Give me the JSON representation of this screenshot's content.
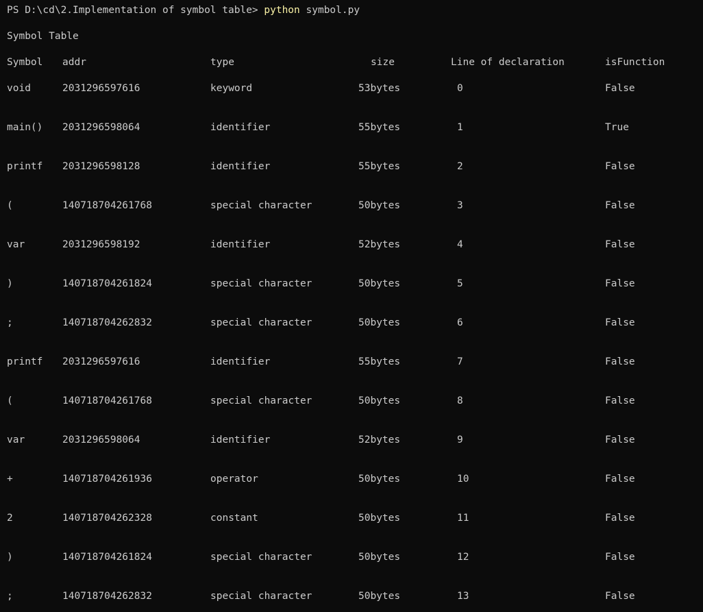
{
  "prompt": {
    "ps_prefix": "PS D:\\cd\\2.Implementation of symbol table> ",
    "command_exe": "python",
    "command_args": " symbol.py"
  },
  "heading": "Symbol Table",
  "table": {
    "headers": {
      "symbol": "Symbol",
      "addr": "addr",
      "type": "type",
      "size": "size",
      "line": "Line of declaration",
      "isfunction": "isFunction"
    },
    "rows": [
      {
        "symbol": "void",
        "addr": "2031296597616",
        "type": "keyword",
        "size": "53bytes",
        "line": "0",
        "isfunction": "False"
      },
      {
        "symbol": "main()",
        "addr": "2031296598064",
        "type": "identifier",
        "size": "55bytes",
        "line": "1",
        "isfunction": "True"
      },
      {
        "symbol": "printf",
        "addr": "2031296598128",
        "type": "identifier",
        "size": "55bytes",
        "line": "2",
        "isfunction": "False"
      },
      {
        "symbol": "(",
        "addr": "140718704261768",
        "type": "special character",
        "size": "50bytes",
        "line": "3",
        "isfunction": "False"
      },
      {
        "symbol": "var",
        "addr": "2031296598192",
        "type": "identifier",
        "size": "52bytes",
        "line": "4",
        "isfunction": "False"
      },
      {
        "symbol": ")",
        "addr": "140718704261824",
        "type": "special character",
        "size": "50bytes",
        "line": "5",
        "isfunction": "False"
      },
      {
        "symbol": ";",
        "addr": "140718704262832",
        "type": "special character",
        "size": "50bytes",
        "line": "6",
        "isfunction": "False"
      },
      {
        "symbol": "printf",
        "addr": "2031296597616",
        "type": "identifier",
        "size": "55bytes",
        "line": "7",
        "isfunction": "False"
      },
      {
        "symbol": "(",
        "addr": "140718704261768",
        "type": "special character",
        "size": "50bytes",
        "line": "8",
        "isfunction": "False"
      },
      {
        "symbol": "var",
        "addr": "2031296598064",
        "type": "identifier",
        "size": "52bytes",
        "line": "9",
        "isfunction": "False"
      },
      {
        "symbol": "+",
        "addr": "140718704261936",
        "type": "operator",
        "size": "50bytes",
        "line": "10",
        "isfunction": "False"
      },
      {
        "symbol": "2",
        "addr": "140718704262328",
        "type": "constant",
        "size": "50bytes",
        "line": "11",
        "isfunction": "False"
      },
      {
        "symbol": ")",
        "addr": "140718704261824",
        "type": "special character",
        "size": "50bytes",
        "line": "12",
        "isfunction": "False"
      },
      {
        "symbol": ";",
        "addr": "140718704262832",
        "type": "special character",
        "size": "50bytes",
        "line": "13",
        "isfunction": "False"
      }
    ]
  },
  "colors": {
    "background": "#0c0c0c",
    "foreground": "#cccccc",
    "command_highlight": "#f9f1a5"
  }
}
